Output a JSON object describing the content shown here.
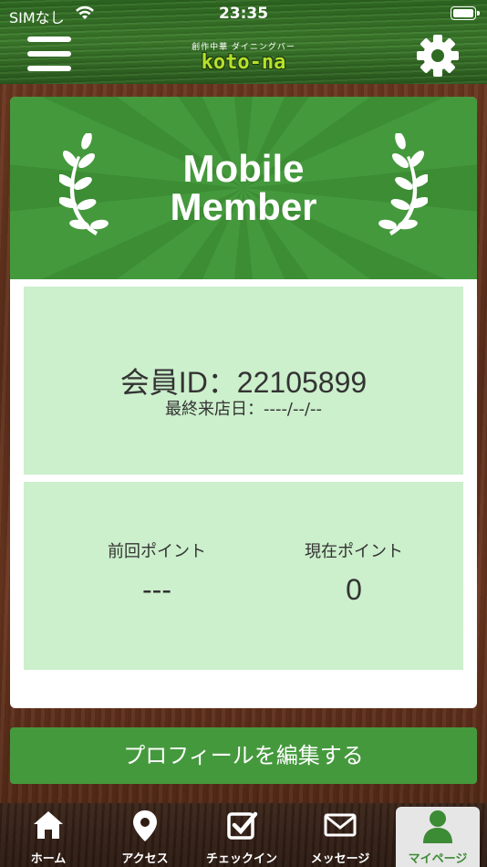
{
  "status_bar": {
    "carrier": "SIMなし",
    "time": "23:35"
  },
  "header": {
    "logo_sub": "創作中華  ダイニングバー",
    "logo_main": "koto-na",
    "menu_icon": "hamburger-menu-icon",
    "settings_icon": "gear-icon"
  },
  "card": {
    "title_line1": "Mobile",
    "title_line2": "Member",
    "member_id": "会員ID：22105899",
    "last_visit": "最終来店日：----/--/--",
    "previous_points_label": "前回ポイント",
    "previous_points_value": "---",
    "current_points_label": "現在ポイント",
    "current_points_value": "0"
  },
  "edit_profile_label": "プロフィールを編集する",
  "tabs": [
    {
      "label": "ホーム",
      "icon": "home-icon"
    },
    {
      "label": "アクセス",
      "icon": "map-pin-icon"
    },
    {
      "label": "チェックイン",
      "icon": "checkbox-icon"
    },
    {
      "label": "メッセージ",
      "icon": "envelope-icon"
    },
    {
      "label": "マイページ",
      "icon": "user-icon"
    }
  ],
  "colors": {
    "accent_green": "#45993d",
    "panel_green": "#ccefcc",
    "active_tab_text": "#3c8b35"
  }
}
